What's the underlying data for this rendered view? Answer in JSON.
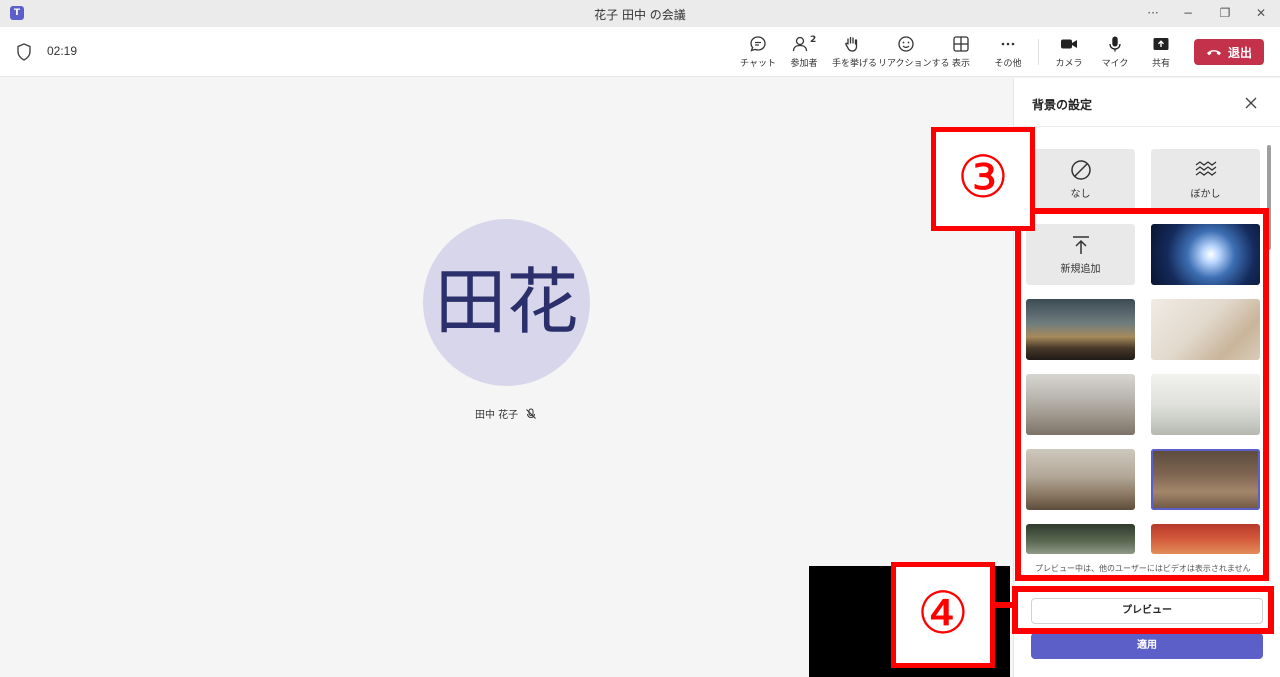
{
  "window": {
    "title": "花子 田中 の会議",
    "app_logo": "T",
    "more": "···",
    "minimize": "−",
    "restore": "❐",
    "close": "✕"
  },
  "toolbar": {
    "timer": "02:19",
    "participants_count": "2",
    "chat": "チャット",
    "participants": "参加者",
    "raise_hand": "手を挙げる",
    "react": "リアクションする",
    "view": "表示",
    "more": "その他",
    "camera": "カメラ",
    "mic": "マイク",
    "share": "共有",
    "leave": "退出"
  },
  "stage": {
    "avatar_initials": "田花",
    "participant_name": "田中 花子"
  },
  "panel": {
    "title": "背景の設定",
    "none_label": "なし",
    "blur_label": "ぼかし",
    "add_label": "新規追加",
    "notice": "プレビュー中は、他のユーザーにはビデオは表示されません",
    "preview_button": "プレビュー",
    "apply_button": "適用"
  },
  "annotations": {
    "label_3": "③",
    "label_4": "④"
  },
  "colors": {
    "accent": "#5b5fc7",
    "leave": "#c4314b",
    "annotation": "#ff0000"
  }
}
